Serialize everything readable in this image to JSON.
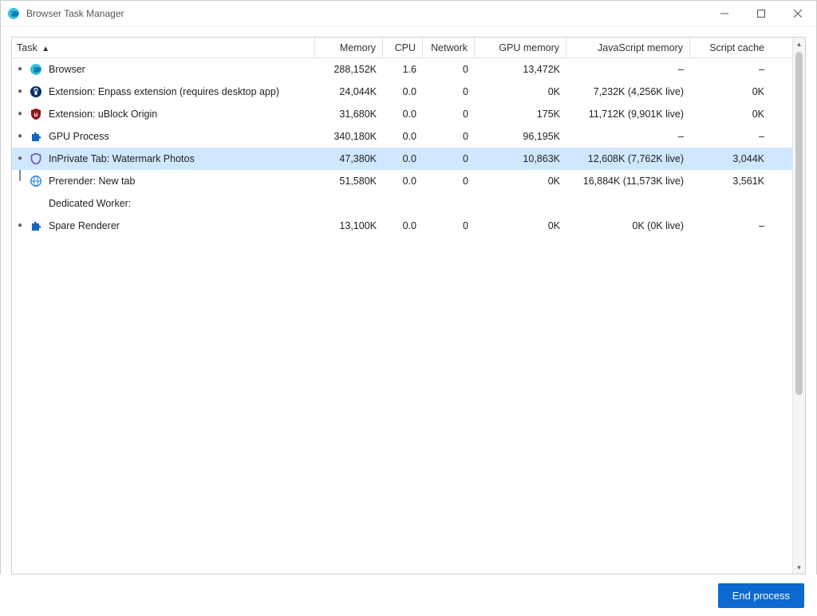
{
  "window": {
    "title": "Browser Task Manager"
  },
  "columns": {
    "task": "Task",
    "memory": "Memory",
    "cpu": "CPU",
    "network": "Network",
    "gpu": "GPU memory",
    "js": "JavaScript memory",
    "script": "Script cache"
  },
  "sort": {
    "column": "task",
    "indicator": "▲"
  },
  "rows": [
    {
      "icon": "edge",
      "name": "Browser",
      "memory": "288,152K",
      "cpu": "1.6",
      "network": "0",
      "gpu": "13,472K",
      "js": "–",
      "script": "–",
      "selected": false
    },
    {
      "icon": "enpass",
      "name": "Extension: Enpass extension (requires desktop app)",
      "memory": "24,044K",
      "cpu": "0.0",
      "network": "0",
      "gpu": "0K",
      "js": "7,232K (4,256K live)",
      "script": "0K",
      "selected": false
    },
    {
      "icon": "ublock",
      "name": "Extension: uBlock Origin",
      "memory": "31,680K",
      "cpu": "0.0",
      "network": "0",
      "gpu": "175K",
      "js": "11,712K (9,901K live)",
      "script": "0K",
      "selected": false
    },
    {
      "icon": "puzzle",
      "name": "GPU Process",
      "memory": "340,180K",
      "cpu": "0.0",
      "network": "0",
      "gpu": "96,195K",
      "js": "–",
      "script": "–",
      "selected": false
    },
    {
      "icon": "shield",
      "name": "InPrivate Tab: Watermark Photos",
      "memory": "47,380K",
      "cpu": "0.0",
      "network": "0",
      "gpu": "10,863K",
      "js": "12,608K (7,762K live)",
      "script": "3,044K",
      "selected": true
    },
    {
      "icon": "globe",
      "name": "Prerender: New tab",
      "memory": "51,580K",
      "cpu": "0.0",
      "network": "0",
      "gpu": "0K",
      "js": "16,884K (11,573K live)",
      "script": "3,561K",
      "selected": false,
      "connector": true
    },
    {
      "icon": "",
      "name": "Dedicated Worker:",
      "memory": "",
      "cpu": "",
      "network": "",
      "gpu": "",
      "js": "",
      "script": "",
      "selected": false,
      "sub": true
    },
    {
      "icon": "puzzle",
      "name": "Spare Renderer",
      "memory": "13,100K",
      "cpu": "0.0",
      "network": "0",
      "gpu": "0K",
      "js": "0K (0K live)",
      "script": "–",
      "selected": false
    }
  ],
  "footer": {
    "end_process": "End process"
  }
}
